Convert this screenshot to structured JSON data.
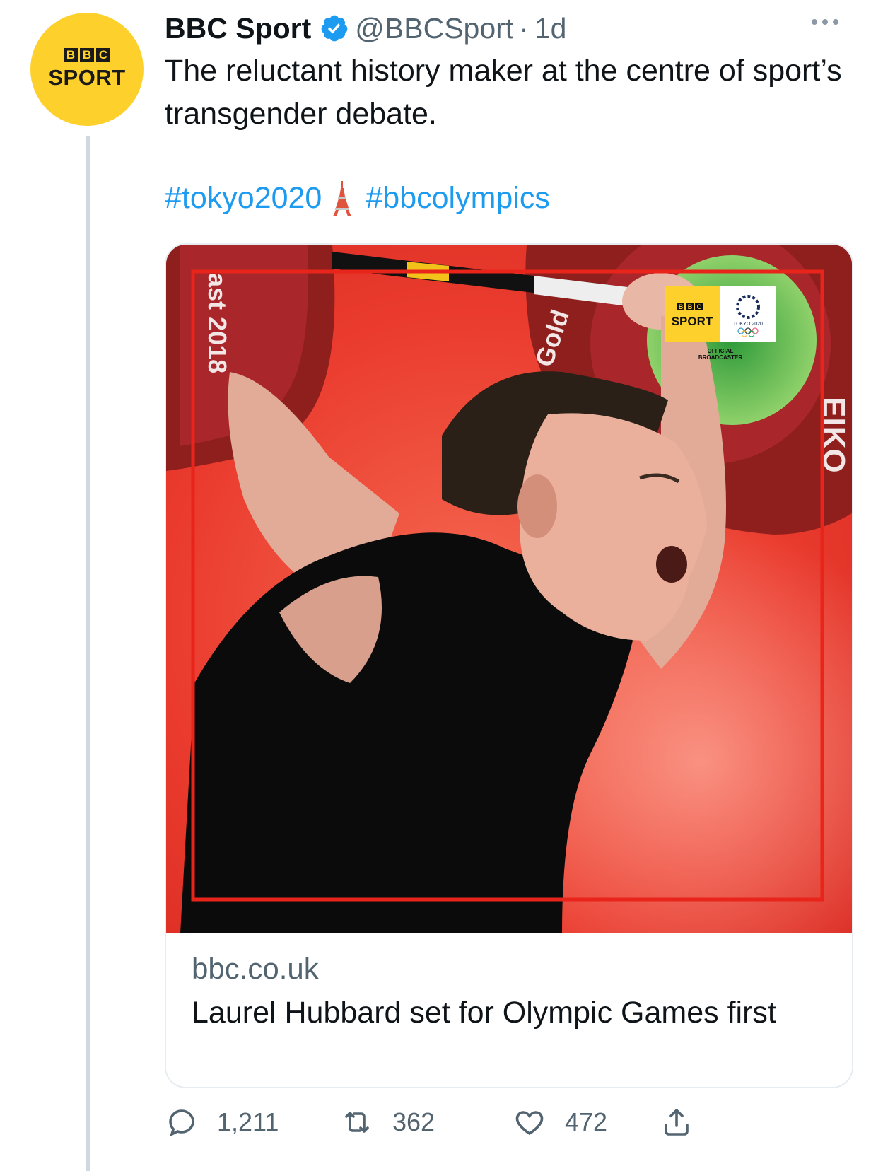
{
  "author": {
    "avatar_text_top": [
      "B",
      "B",
      "C"
    ],
    "avatar_text_bottom": "SPORT",
    "name": "BBC Sport",
    "handle": "@BBCSport",
    "separator": "·",
    "time": "1d"
  },
  "tweet": {
    "text": "The reluctant history maker at the centre of sport’s transgender debate.",
    "hashtags": [
      "#tokyo2020",
      "#bbcolympics"
    ]
  },
  "card": {
    "image_overlay": {
      "bbc_blocks": [
        "B",
        "B",
        "C"
      ],
      "sport": "SPORT",
      "tokyo": "TOKYO 2020",
      "broadcaster_line1": "OFFICIAL",
      "broadcaster_line2": "BROADCASTER",
      "plate_text_left": "ast 2018",
      "plate_text_right": "Gold",
      "plate_text_edge": "EIKO"
    },
    "domain": "bbc.co.uk",
    "title": "Laurel Hubbard set for Olympic Games first"
  },
  "actions": {
    "replies": "1,211",
    "retweets": "362",
    "likes": "472"
  },
  "colors": {
    "accent": "#1d9bf0",
    "avatar_yellow": "#fdd02c",
    "image_red": "#ea3b2e"
  }
}
